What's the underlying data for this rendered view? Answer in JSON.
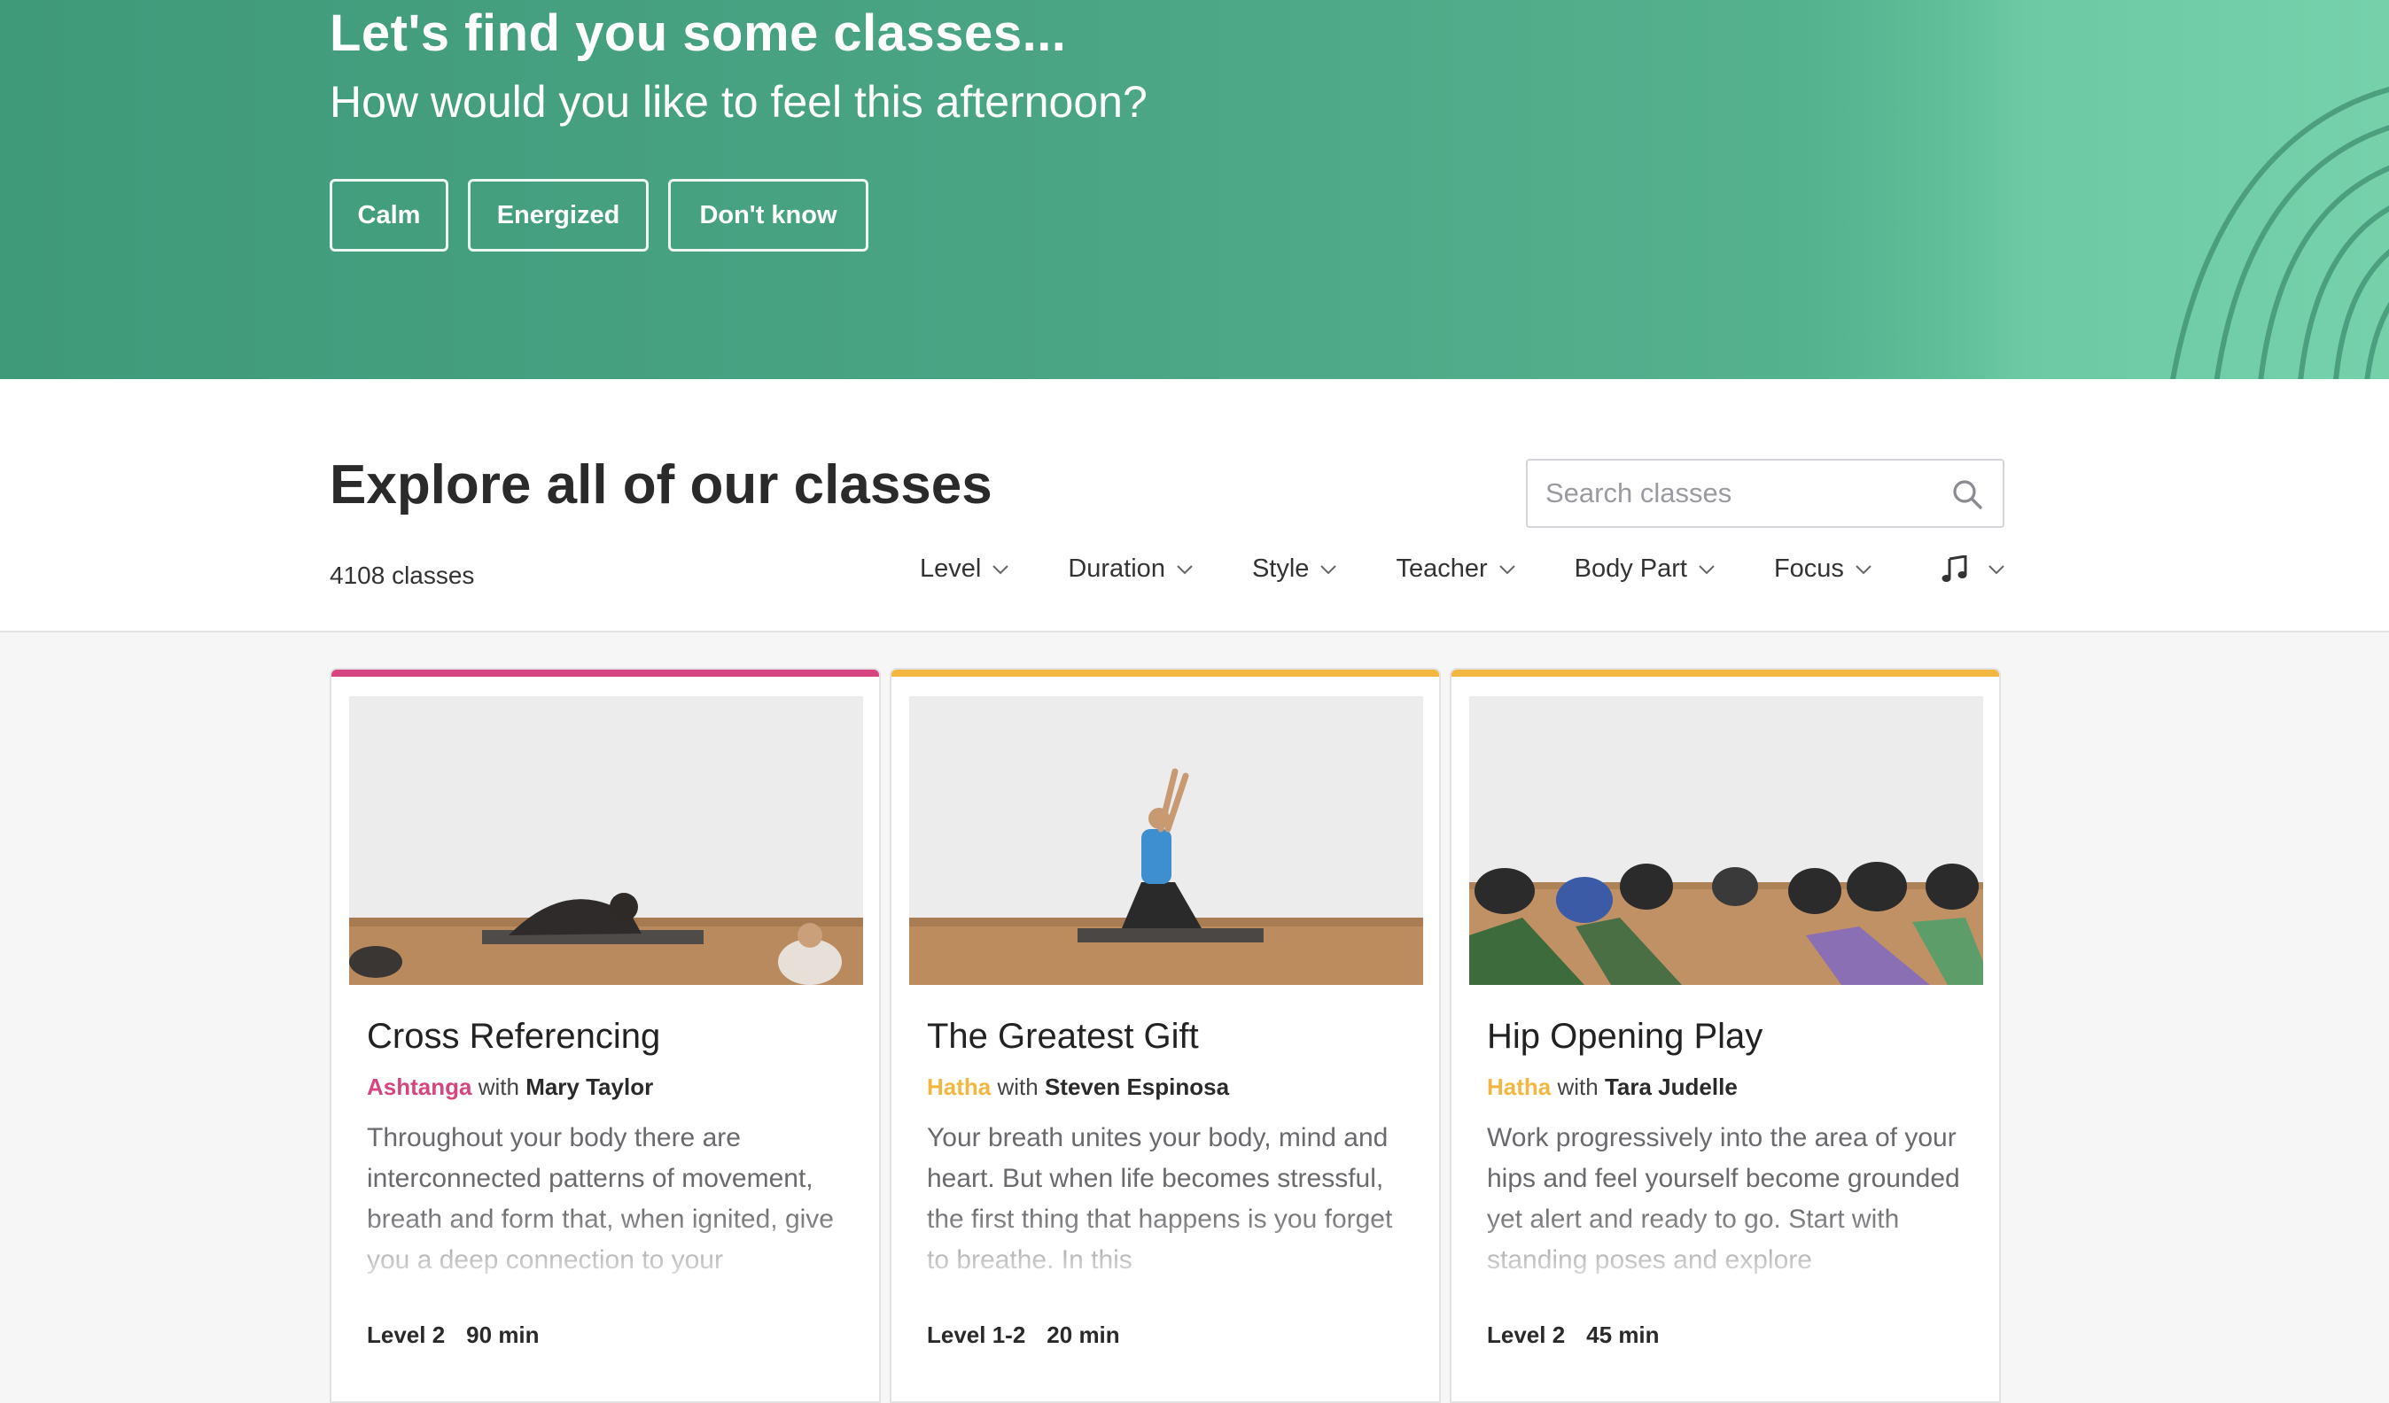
{
  "hero": {
    "title": "Let's find you some classes...",
    "subtitle": "How would you like to feel this afternoon?",
    "moods": [
      "Calm",
      "Energized",
      "Don't know"
    ],
    "bg_color": "#4aa585"
  },
  "explore": {
    "title": "Explore all of our classes",
    "count": "4108 classes",
    "search_placeholder": "Search classes",
    "filters": [
      "Level",
      "Duration",
      "Style",
      "Teacher",
      "Body Part",
      "Focus"
    ],
    "music_filter_icon": "music-note-icon"
  },
  "cards": [
    {
      "title": "Cross Referencing",
      "style": "Ashtanga",
      "with": "with",
      "teacher": "Mary Taylor",
      "description": "Throughout your body there are interconnected patterns of movement, breath and form that, when ignited, give you a deep connection to your",
      "level": "Level 2",
      "duration": "90 min",
      "accent": "#d6457f"
    },
    {
      "title": "The Greatest Gift",
      "style": "Hatha",
      "with": "with",
      "teacher": "Steven Espinosa",
      "description": "Your breath unites your body, mind and heart. But when life becomes stressful, the first thing that happens is you forget to breathe. In this",
      "level": "Level 1-2",
      "duration": "20 min",
      "accent": "#f2b740"
    },
    {
      "title": "Hip Opening Play",
      "style": "Hatha",
      "with": "with",
      "teacher": "Tara Judelle",
      "description": "Work progressively into the area of your hips and feel yourself become grounded yet alert and ready to go. Start with standing poses and explore",
      "level": "Level 2",
      "duration": "45 min",
      "accent": "#f2b740"
    }
  ]
}
